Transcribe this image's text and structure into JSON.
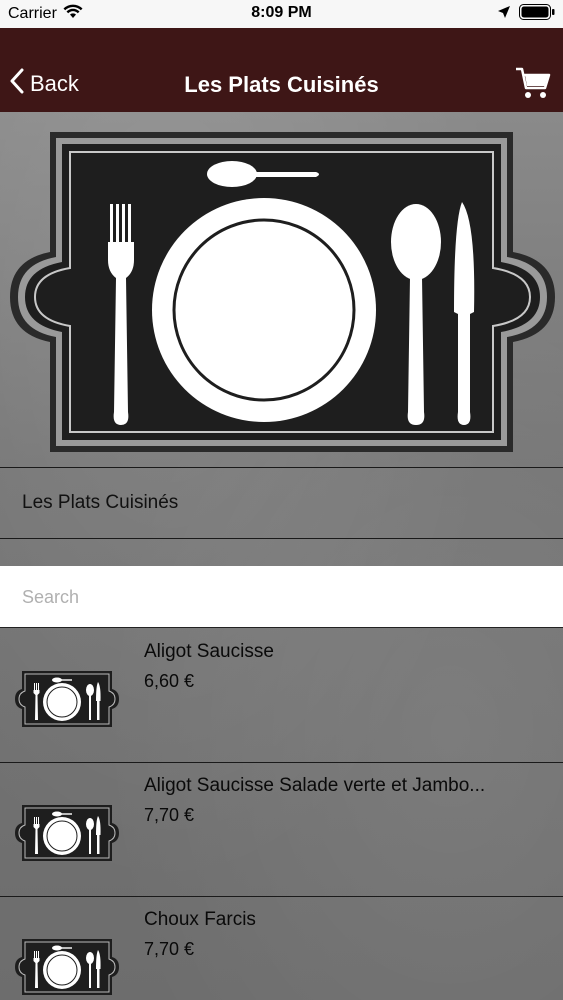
{
  "status": {
    "carrier": "Carrier",
    "time": "8:09 PM"
  },
  "nav": {
    "back_label": "Back",
    "title": "Les Plats Cuisinés"
  },
  "category": {
    "label": "Les Plats Cuisinés"
  },
  "search": {
    "placeholder": "Search",
    "value": ""
  },
  "items": [
    {
      "name": "Aligot Saucisse",
      "price": "6,60 €"
    },
    {
      "name": "Aligot Saucisse Salade verte et Jambo...",
      "price": "7,70 €"
    },
    {
      "name": "Choux Farcis",
      "price": "7,70 €"
    }
  ],
  "colors": {
    "nav_background": "#3e1616",
    "board": "#757575",
    "placemat": "#1e1e1e"
  }
}
